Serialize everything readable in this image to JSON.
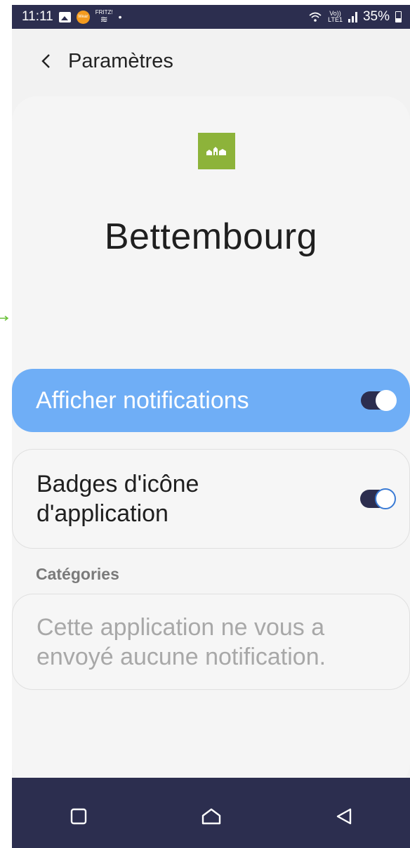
{
  "status_bar": {
    "time": "11:11",
    "wear_label": "Wear",
    "fritz_label": "FRITZ!",
    "dot": "•",
    "volte_top": "Vo))",
    "volte_bottom": "LTE1",
    "battery_percent": "35%"
  },
  "header": {
    "back_icon": "chevron-left-icon",
    "title": "Paramètres"
  },
  "app": {
    "icon": "app-logo-icon",
    "icon_color": "#8db33a",
    "name": "Bettembourg"
  },
  "settings": {
    "show_notifications": {
      "label": "Afficher notifications",
      "enabled": true
    },
    "app_icon_badges": {
      "label": "Badges d'icône d'application",
      "enabled": true
    }
  },
  "categories": {
    "heading": "Catégories",
    "empty_message": "Cette application ne vous a envoyé aucune notification."
  },
  "navigation": {
    "recents_icon": "square-icon",
    "home_icon": "home-icon",
    "back_icon": "triangle-back-icon"
  },
  "colors": {
    "status_bar_bg": "#2c2e4f",
    "highlight": "#6faef6",
    "toggle_track": "#2c2e4f",
    "toggle_outline": "#3a7bd5"
  }
}
